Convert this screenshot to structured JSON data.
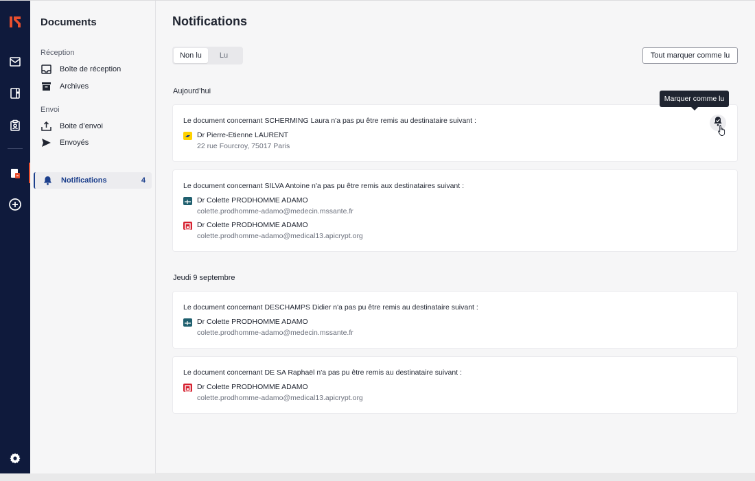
{
  "sidebar": {
    "title": "Documents",
    "reception_label": "Réception",
    "envoi_label": "Envoi",
    "items": [
      {
        "label": "Boîte de réception"
      },
      {
        "label": "Archives"
      },
      {
        "label": "Boite d’envoi"
      },
      {
        "label": "Envoyés"
      },
      {
        "label": "Notifications",
        "count": "4"
      }
    ]
  },
  "main": {
    "title": "Notifications",
    "tabs": [
      {
        "label": "Non lu"
      },
      {
        "label": "Lu"
      }
    ],
    "mark_all_label": "Tout marquer comme lu",
    "tooltip": "Marquer comme lu",
    "groups": [
      {
        "label": "Aujourd’hui",
        "cards": [
          {
            "message": "Le document concernant SCHERMING Laura n'a pas pu être remis au destinataire suivant :",
            "recipients": [
              {
                "name": "Dr Pierre-Etienne LAURENT",
                "address": "22 rue Fourcroy, 75017 Paris",
                "icon": "la-poste-icon"
              }
            ]
          },
          {
            "message": "Le document concernant SILVA Antoine n'a pas pu être remis aux destinataires suivant :",
            "recipients": [
              {
                "name": "Dr Colette PRODHOMME ADAMO",
                "address": "colette.prodhomme-adamo@medecin.mssante.fr",
                "icon": "mssante-icon"
              },
              {
                "name": "Dr Colette PRODHOMME ADAMO",
                "address": "colette.prodhomme-adamo@medical13.apicrypt.org",
                "icon": "apicrypt-icon"
              }
            ]
          }
        ]
      },
      {
        "label": "Jeudi 9 septembre",
        "cards": [
          {
            "message": "Le document concernant DESCHAMPS Didier n'a pas pu être remis au destinataire suivant :",
            "recipients": [
              {
                "name": "Dr Colette PRODHOMME ADAMO",
                "address": "colette.prodhomme-adamo@medecin.mssante.fr",
                "icon": "mssante-icon"
              }
            ]
          },
          {
            "message": "Le document concernant DE SA Raphaël n'a pas pu être remis au destinataire suivant :",
            "recipients": [
              {
                "name": "Dr Colette PRODHOMME ADAMO",
                "address": "colette.prodhomme-adamo@medical13.apicrypt.org",
                "icon": "apicrypt-icon"
              }
            ]
          }
        ]
      }
    ]
  },
  "colors": {
    "rail": "#0f1a3c",
    "accent": "#1c3f8c",
    "brand": "#e94f2e",
    "la_poste": "#ffd200",
    "mssante": "#1f5f6e",
    "apicrypt": "#d6202f"
  }
}
